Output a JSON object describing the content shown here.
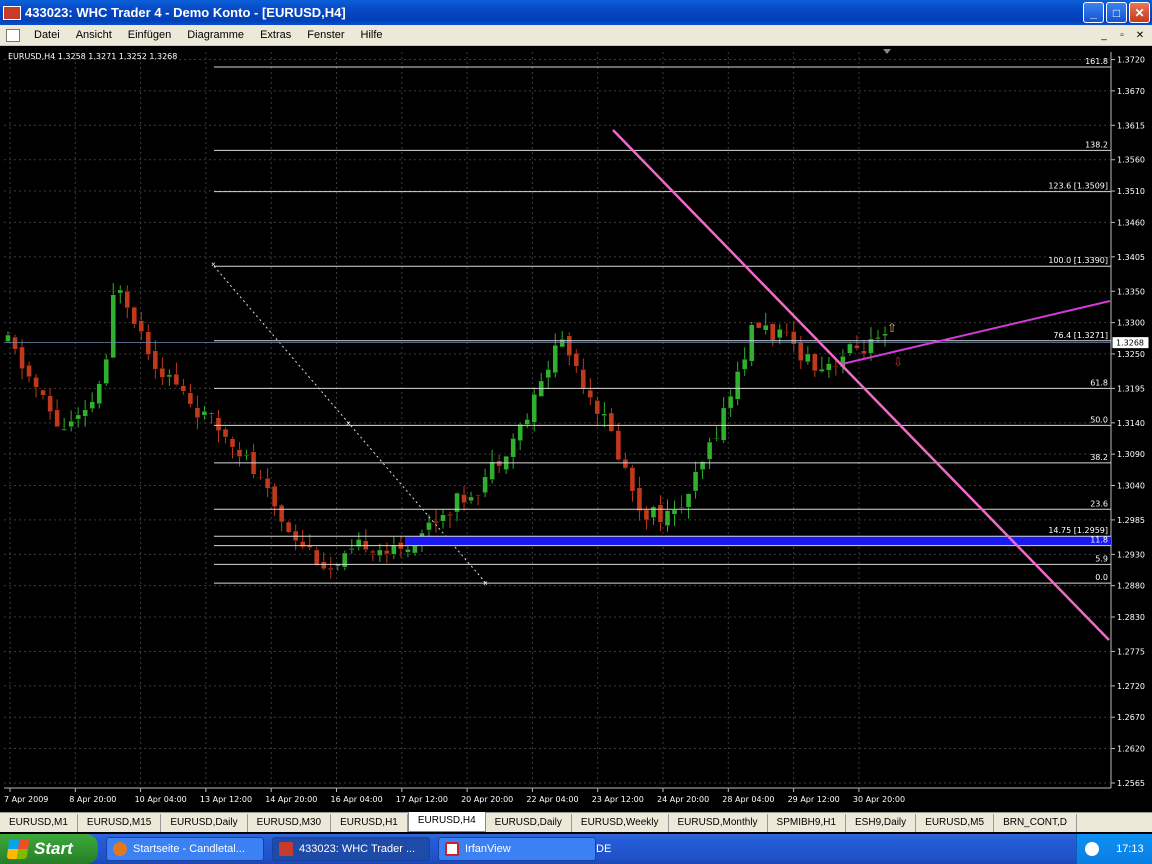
{
  "window": {
    "title": "433023: WHC Trader 4 - Demo Konto - [EURUSD,H4]",
    "minimize": "_",
    "maximize": "□",
    "close": "✕"
  },
  "menu": [
    "Datei",
    "Ansicht",
    "Einfügen",
    "Diagramme",
    "Extras",
    "Fenster",
    "Hilfe"
  ],
  "mdi_controls": [
    "_",
    "▫",
    "✕"
  ],
  "chart": {
    "info": "EURUSD,H4  1.3258 1.3271 1.3252 1.3268",
    "current_price": "1.3268",
    "price_labels": [
      "1.3720",
      "1.3670",
      "1.3615",
      "1.3560",
      "1.3510",
      "1.3460",
      "1.3405",
      "1.3350",
      "1.3300",
      "1.3250",
      "1.3195",
      "1.3140",
      "1.3090",
      "1.3040",
      "1.2985",
      "1.2930",
      "1.2880",
      "1.2830",
      "1.2775",
      "1.2720",
      "1.2670",
      "1.2620",
      "1.2565"
    ],
    "time_labels": [
      "7 Apr 2009",
      "8 Apr 20:00",
      "10 Apr 04:00",
      "13 Apr 12:00",
      "14 Apr 20:00",
      "16 Apr 04:00",
      "17 Apr 12:00",
      "20 Apr 20:00",
      "22 Apr 04:00",
      "23 Apr 12:00",
      "24 Apr 20:00",
      "28 Apr 04:00",
      "29 Apr 12:00",
      "30 Apr 20:00"
    ],
    "fib_levels": [
      {
        "label": "161.8",
        "price": 1.3708
      },
      {
        "label": "138.2",
        "price": 1.3575
      },
      {
        "label": "123.6  [1.3509]",
        "price": 1.3509
      },
      {
        "label": "100.0  [1.3390]",
        "price": 1.339
      },
      {
        "label": "76.4  [1.3271]",
        "price": 1.3271
      },
      {
        "label": "61.8",
        "price": 1.3195
      },
      {
        "label": "50.0",
        "price": 1.3136
      },
      {
        "label": "38.2",
        "price": 1.3076
      },
      {
        "label": "23.6",
        "price": 1.3002
      },
      {
        "label": "14.75  [1.2959]",
        "price": 1.2959
      },
      {
        "label": "11.8",
        "price": 1.2944
      },
      {
        "label": "5.9",
        "price": 1.2914
      },
      {
        "label": "0.0",
        "price": 1.2884
      }
    ],
    "colors": {
      "bull": "#2fb02f",
      "bear": "#c0391c",
      "grid": "#3c3c3c",
      "fib": "#d8d8d8",
      "trend_down": "#f06ac8",
      "trend_up": "#d43ad8",
      "zone": "#1a1af0"
    }
  },
  "tabs": [
    {
      "label": "EURUSD,M1"
    },
    {
      "label": "EURUSD,M15"
    },
    {
      "label": "EURUSD,Daily"
    },
    {
      "label": "EURUSD,M30"
    },
    {
      "label": "EURUSD,H1"
    },
    {
      "label": "EURUSD,H4",
      "active": true
    },
    {
      "label": "EURUSD,Daily"
    },
    {
      "label": "EURUSD,Weekly"
    },
    {
      "label": "EURUSD,Monthly"
    },
    {
      "label": "SPMIBH9,H1"
    },
    {
      "label": "ESH9,Daily"
    },
    {
      "label": "EURUSD,M5"
    },
    {
      "label": "BRN_CONT,D"
    }
  ],
  "taskbar": {
    "start": "Start",
    "tasks": [
      {
        "label": "Startseite - Candletal...",
        "color": "#e07a20"
      },
      {
        "label": "433023: WHC Trader ...",
        "color": "#c83a2a",
        "active": true
      },
      {
        "label": "IrfanView",
        "color": "#d02020"
      }
    ],
    "lang": "DE",
    "clock": "17:13"
  }
}
